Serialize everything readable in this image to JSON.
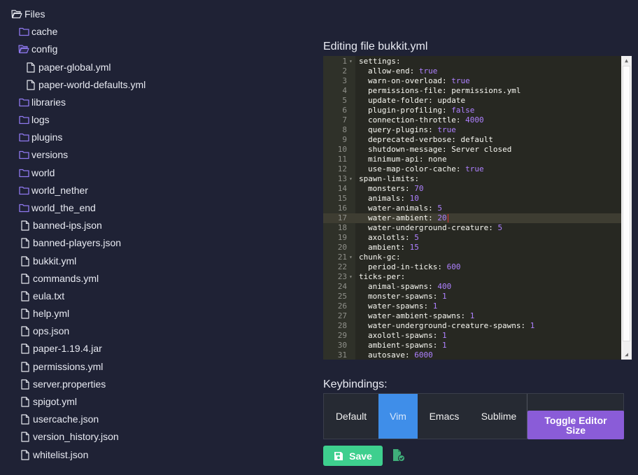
{
  "tree": {
    "root": {
      "label": "Files",
      "icon": "folder-open-icon"
    },
    "items": [
      {
        "label": "cache",
        "type": "folder",
        "depth": 1
      },
      {
        "label": "config",
        "type": "folder-open",
        "depth": 1
      },
      {
        "label": "paper-global.yml",
        "type": "file",
        "depth": 2
      },
      {
        "label": "paper-world-defaults.yml",
        "type": "file",
        "depth": 2
      },
      {
        "label": "libraries",
        "type": "folder",
        "depth": 1
      },
      {
        "label": "logs",
        "type": "folder",
        "depth": 1
      },
      {
        "label": "plugins",
        "type": "folder",
        "depth": 1
      },
      {
        "label": "versions",
        "type": "folder",
        "depth": 1
      },
      {
        "label": "world",
        "type": "folder",
        "depth": 1
      },
      {
        "label": "world_nether",
        "type": "folder",
        "depth": 1
      },
      {
        "label": "world_the_end",
        "type": "folder",
        "depth": 1
      },
      {
        "label": "banned-ips.json",
        "type": "file",
        "depth": 1
      },
      {
        "label": "banned-players.json",
        "type": "file",
        "depth": 1
      },
      {
        "label": "bukkit.yml",
        "type": "file",
        "depth": 1
      },
      {
        "label": "commands.yml",
        "type": "file",
        "depth": 1
      },
      {
        "label": "eula.txt",
        "type": "file",
        "depth": 1
      },
      {
        "label": "help.yml",
        "type": "file",
        "depth": 1
      },
      {
        "label": "ops.json",
        "type": "file",
        "depth": 1
      },
      {
        "label": "paper-1.19.4.jar",
        "type": "file",
        "depth": 1
      },
      {
        "label": "permissions.yml",
        "type": "file",
        "depth": 1
      },
      {
        "label": "server.properties",
        "type": "file",
        "depth": 1
      },
      {
        "label": "spigot.yml",
        "type": "file",
        "depth": 1
      },
      {
        "label": "usercache.json",
        "type": "file",
        "depth": 1
      },
      {
        "label": "version_history.json",
        "type": "file",
        "depth": 1
      },
      {
        "label": "whitelist.json",
        "type": "file",
        "depth": 1
      }
    ]
  },
  "editor": {
    "title": "Editing file bukkit.yml",
    "active_line": 17,
    "lines": [
      {
        "n": "1",
        "fold": true,
        "indent": 0,
        "key": "settings",
        "value": "",
        "vt": ""
      },
      {
        "n": "2",
        "indent": 1,
        "key": "allow-end",
        "value": "true",
        "vt": "bool"
      },
      {
        "n": "3",
        "indent": 1,
        "key": "warn-on-overload",
        "value": "true",
        "vt": "bool"
      },
      {
        "n": "4",
        "indent": 1,
        "key": "permissions-file",
        "value": "permissions.yml",
        "vt": "str"
      },
      {
        "n": "5",
        "indent": 1,
        "key": "update-folder",
        "value": "update",
        "vt": "str"
      },
      {
        "n": "6",
        "indent": 1,
        "key": "plugin-profiling",
        "value": "false",
        "vt": "bool"
      },
      {
        "n": "7",
        "indent": 1,
        "key": "connection-throttle",
        "value": "4000",
        "vt": "num"
      },
      {
        "n": "8",
        "indent": 1,
        "key": "query-plugins",
        "value": "true",
        "vt": "bool"
      },
      {
        "n": "9",
        "indent": 1,
        "key": "deprecated-verbose",
        "value": "default",
        "vt": "str"
      },
      {
        "n": "10",
        "indent": 1,
        "key": "shutdown-message",
        "value": "Server closed",
        "vt": "str"
      },
      {
        "n": "11",
        "indent": 1,
        "key": "minimum-api",
        "value": "none",
        "vt": "str"
      },
      {
        "n": "12",
        "indent": 1,
        "key": "use-map-color-cache",
        "value": "true",
        "vt": "bool"
      },
      {
        "n": "13",
        "fold": true,
        "indent": 0,
        "key": "spawn-limits",
        "value": "",
        "vt": ""
      },
      {
        "n": "14",
        "indent": 1,
        "key": "monsters",
        "value": "70",
        "vt": "num"
      },
      {
        "n": "15",
        "indent": 1,
        "key": "animals",
        "value": "10",
        "vt": "num"
      },
      {
        "n": "16",
        "indent": 1,
        "key": "water-animals",
        "value": "5",
        "vt": "num"
      },
      {
        "n": "17",
        "indent": 1,
        "key": "water-ambient",
        "value": "20",
        "vt": "num"
      },
      {
        "n": "18",
        "indent": 1,
        "key": "water-underground-creature",
        "value": "5",
        "vt": "num"
      },
      {
        "n": "19",
        "indent": 1,
        "key": "axolotls",
        "value": "5",
        "vt": "num"
      },
      {
        "n": "20",
        "indent": 1,
        "key": "ambient",
        "value": "15",
        "vt": "num"
      },
      {
        "n": "21",
        "fold": true,
        "indent": 0,
        "key": "chunk-gc",
        "value": "",
        "vt": ""
      },
      {
        "n": "22",
        "indent": 1,
        "key": "period-in-ticks",
        "value": "600",
        "vt": "num"
      },
      {
        "n": "23",
        "fold": true,
        "indent": 0,
        "key": "ticks-per",
        "value": "",
        "vt": ""
      },
      {
        "n": "24",
        "indent": 1,
        "key": "animal-spawns",
        "value": "400",
        "vt": "num"
      },
      {
        "n": "25",
        "indent": 1,
        "key": "monster-spawns",
        "value": "1",
        "vt": "num"
      },
      {
        "n": "26",
        "indent": 1,
        "key": "water-spawns",
        "value": "1",
        "vt": "num"
      },
      {
        "n": "27",
        "indent": 1,
        "key": "water-ambient-spawns",
        "value": "1",
        "vt": "num"
      },
      {
        "n": "28",
        "indent": 1,
        "key": "water-underground-creature-spawns",
        "value": "1",
        "vt": "num"
      },
      {
        "n": "29",
        "indent": 1,
        "key": "axolotl-spawns",
        "value": "1",
        "vt": "num"
      },
      {
        "n": "30",
        "indent": 1,
        "key": "ambient-spawns",
        "value": "1",
        "vt": "num"
      },
      {
        "n": "31",
        "indent": 1,
        "key": "autosave",
        "value": "6000",
        "vt": "num"
      }
    ]
  },
  "keybindings": {
    "title": "Keybindings:",
    "options": [
      "Default",
      "Vim",
      "Emacs",
      "Sublime"
    ],
    "selected": "Vim",
    "toggle_label": "Toggle Editor Size"
  },
  "actions": {
    "save_label": "Save"
  },
  "colors": {
    "background": "#1f2235",
    "folder": "#8f79f0",
    "vim_active": "#3f8ee9",
    "toggle": "#8a5cd8",
    "save": "#3ecf8e"
  }
}
